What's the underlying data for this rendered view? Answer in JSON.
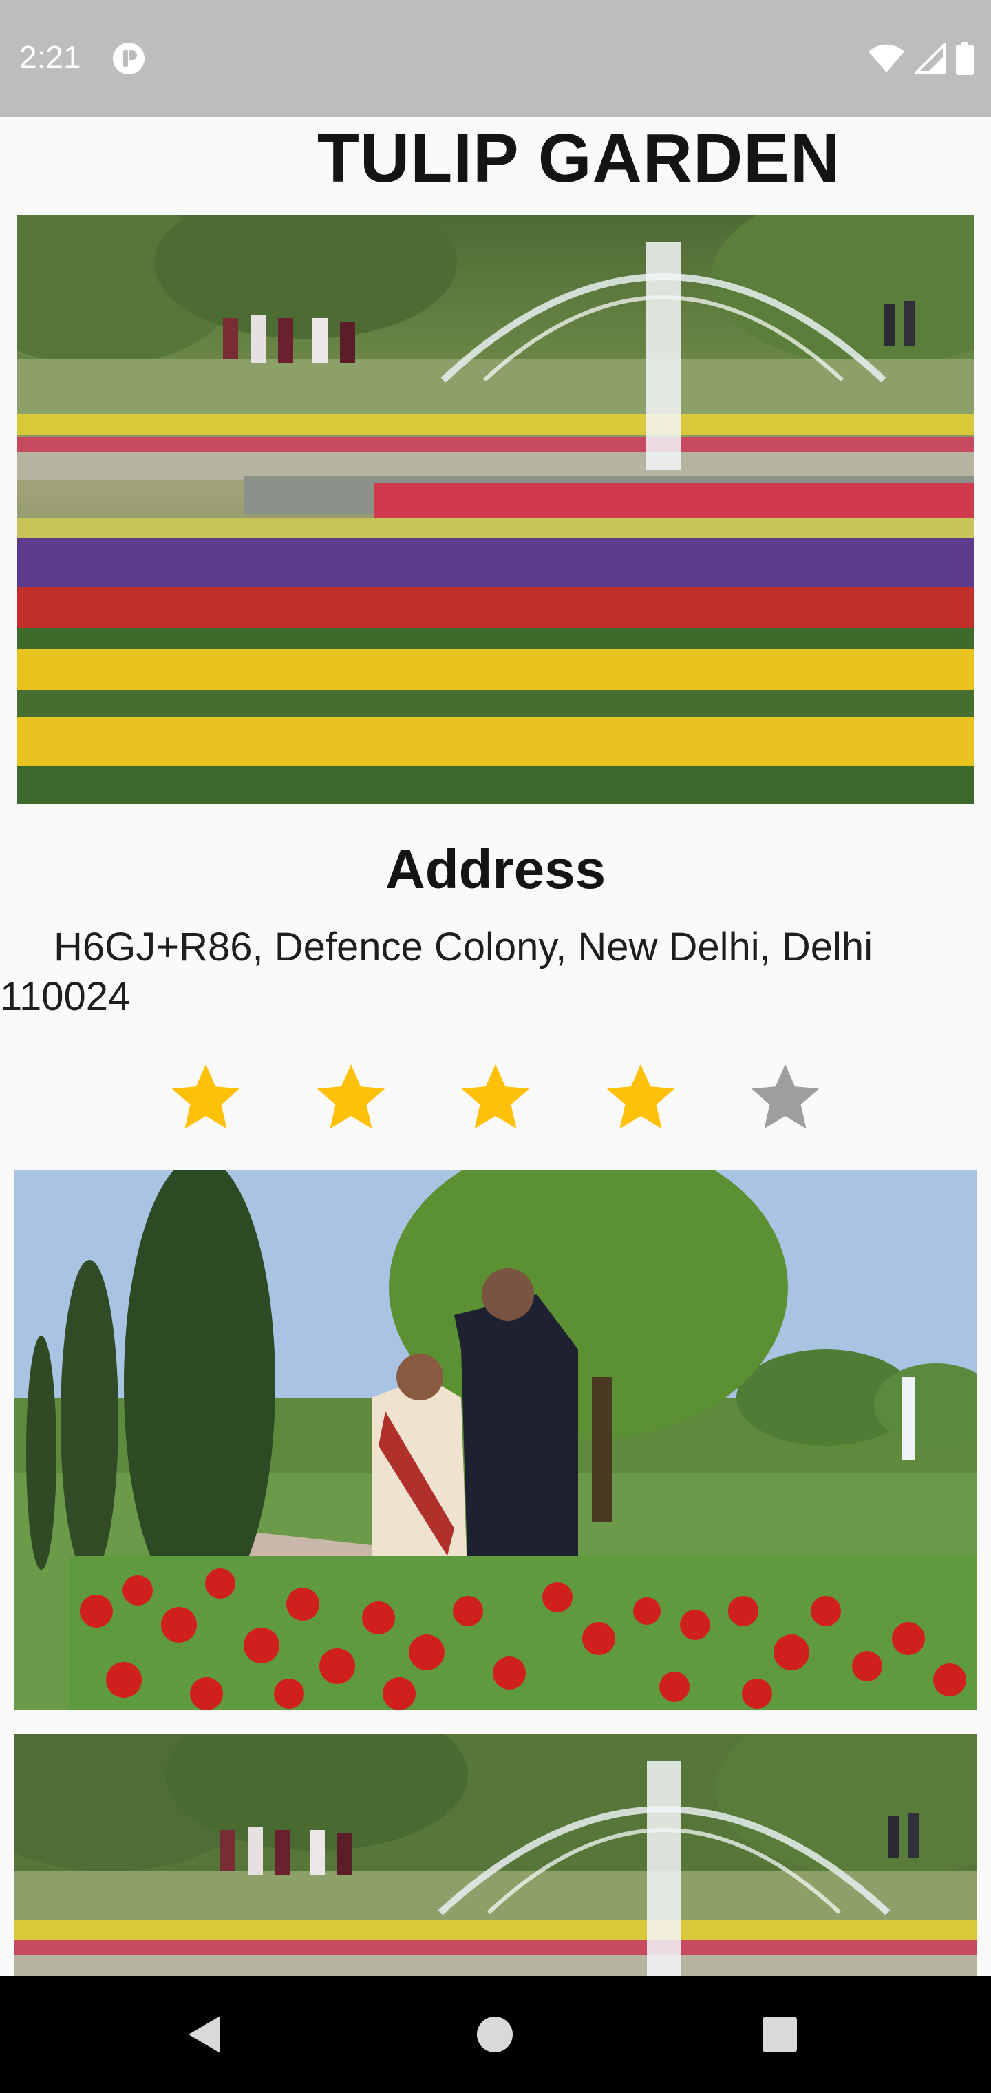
{
  "status_bar": {
    "time": "2:21",
    "icons": [
      "app-notification-icon",
      "wifi-icon",
      "cellular-signal-icon",
      "battery-icon"
    ]
  },
  "page": {
    "title": "TULIP GARDEN"
  },
  "address": {
    "heading": "Address",
    "text": "H6GJ+R86, Defence Colony, New Delhi, Delhi 110024"
  },
  "rating": {
    "value": 4,
    "max": 5,
    "filled_color": "#ffc107",
    "empty_color": "#9e9e9e"
  },
  "navigation": {
    "buttons": [
      "back-icon",
      "home-icon",
      "recents-icon"
    ]
  }
}
